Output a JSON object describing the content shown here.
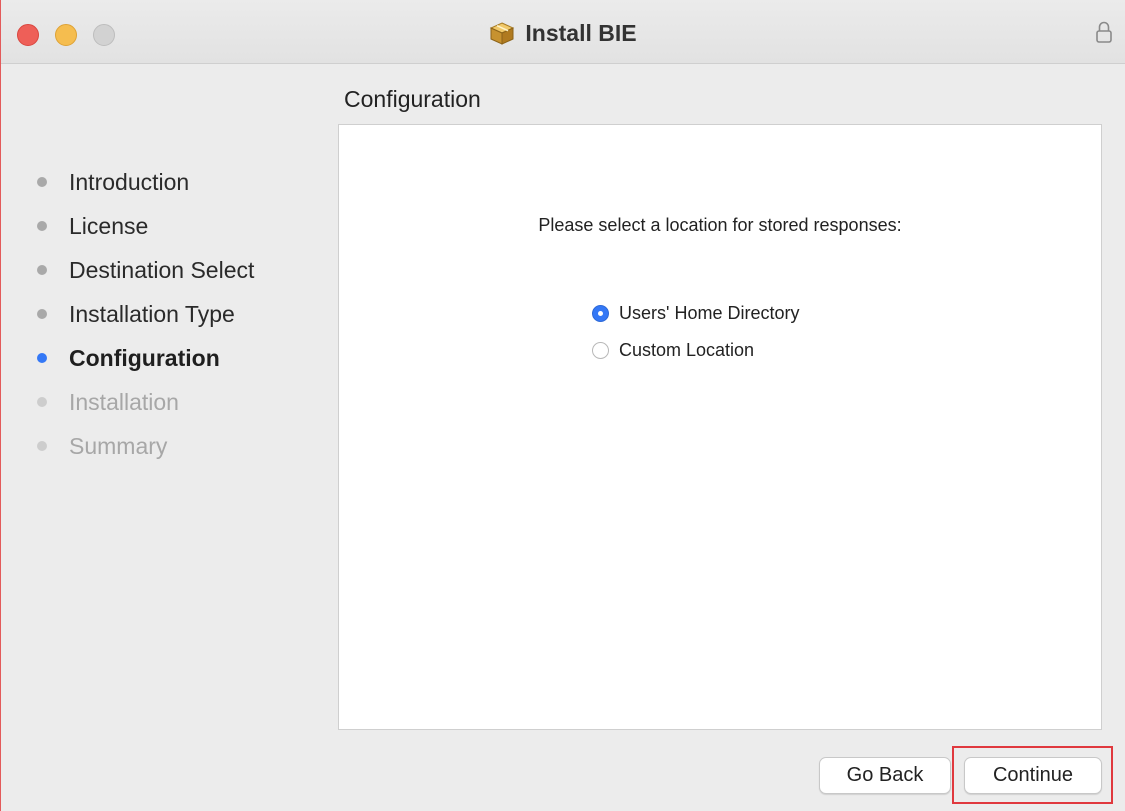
{
  "window": {
    "title": "Install BIE",
    "title_icon": "package-icon",
    "lock_icon": "lock-icon",
    "traffic_colors": {
      "close": "#ee5f58",
      "minimize": "#f5bd4f",
      "maximize": "#d2d2d2"
    }
  },
  "steps": [
    {
      "label": "Introduction",
      "state": "done"
    },
    {
      "label": "License",
      "state": "done"
    },
    {
      "label": "Destination Select",
      "state": "done"
    },
    {
      "label": "Installation Type",
      "state": "done"
    },
    {
      "label": "Configuration",
      "state": "current"
    },
    {
      "label": "Installation",
      "state": "pending"
    },
    {
      "label": "Summary",
      "state": "pending"
    }
  ],
  "main": {
    "section_title": "Configuration",
    "prompt": "Please select a location for stored responses:",
    "options": [
      {
        "label": "Users' Home Directory",
        "selected": true
      },
      {
        "label": "Custom Location",
        "selected": false
      }
    ]
  },
  "buttons": {
    "back_label": "Go Back",
    "continue_label": "Continue"
  },
  "colors": {
    "accent": "#3478f6",
    "highlight": "#e0393e"
  }
}
